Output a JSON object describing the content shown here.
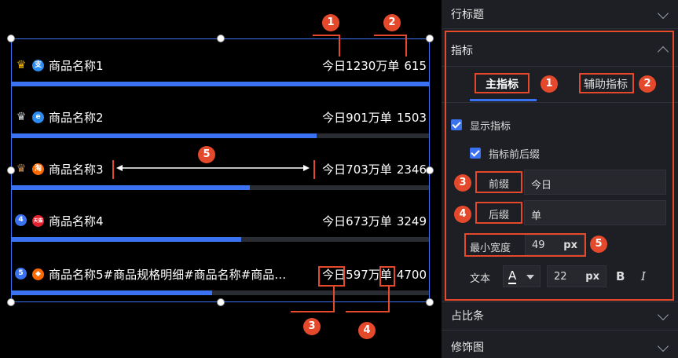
{
  "canvas": {
    "rows": [
      {
        "name": "商品名称1",
        "prefix": "今日",
        "value": "1230",
        "suffix": "万单",
        "count": "615",
        "bar_fraction": 1.0,
        "rank_icon": "gold-crown-icon",
        "rank_color": "#f5b400",
        "app_icon": "alipay-icon",
        "app_glyph": "支",
        "app_color": "#2d8cf0"
      },
      {
        "name": "商品名称2",
        "prefix": "今日",
        "value": "901",
        "suffix": "万单",
        "count": "1503",
        "bar_fraction": 0.73,
        "rank_icon": "silver-crown-icon",
        "rank_color": "#d0d4dc",
        "app_icon": "ie-browser-icon",
        "app_glyph": "e",
        "app_color": "#2d8cf0"
      },
      {
        "name": "商品名称3",
        "prefix": "今日",
        "value": "703",
        "suffix": "万单",
        "count": "2346",
        "bar_fraction": 0.57,
        "rank_icon": "bronze-crown-icon",
        "rank_color": "#c68b4f",
        "app_icon": "taobao-icon",
        "app_glyph": "淘",
        "app_color": "#ff6a00"
      },
      {
        "name": "商品名称4",
        "prefix": "今日",
        "value": "673",
        "suffix": "万单",
        "count": "3249",
        "bar_fraction": 0.55,
        "rank_icon": "rank-4-icon",
        "rank_label": "4",
        "rank_color": "#3b72f1",
        "app_icon": "tmall-icon",
        "app_glyph": "天猫",
        "app_color": "#e5202e"
      },
      {
        "name": "商品名称5#商品规格明细#商品名称#商品…",
        "prefix": "今日",
        "value": "597",
        "suffix": "万单",
        "count": "4700",
        "bar_fraction": 0.48,
        "rank_icon": "rank-5-icon",
        "rank_label": "5",
        "rank_color": "#3b72f1",
        "app_icon": "shield-icon",
        "app_glyph": "◆",
        "app_color": "#ff6a00"
      }
    ]
  },
  "annotations": {
    "b1": "1",
    "b2": "2",
    "b3": "3",
    "b4": "4",
    "b5": "5"
  },
  "panel": {
    "row_title": "行标题",
    "metric_title": "指标",
    "tab_main": "主指标",
    "tab_aux": "辅助指标",
    "show_metric": "显示指标",
    "prefix_suffix": "指标前后缀",
    "prefix_label": "前缀",
    "prefix_value": "今日",
    "suffix_label": "后缀",
    "suffix_value": "单",
    "min_width_label": "最小宽度",
    "min_width_value": "49",
    "min_width_unit": "px",
    "text_label": "文本",
    "font_color_glyph": "A",
    "font_size_value": "22",
    "font_size_unit": "px",
    "bold_glyph": "B",
    "italic_glyph": "I",
    "ratio_bar": "占比条",
    "decoration": "修饰图"
  },
  "colors": {
    "accent": "#3b72f1",
    "annotation": "#e5492c",
    "panel_bg": "#1d1f24"
  }
}
